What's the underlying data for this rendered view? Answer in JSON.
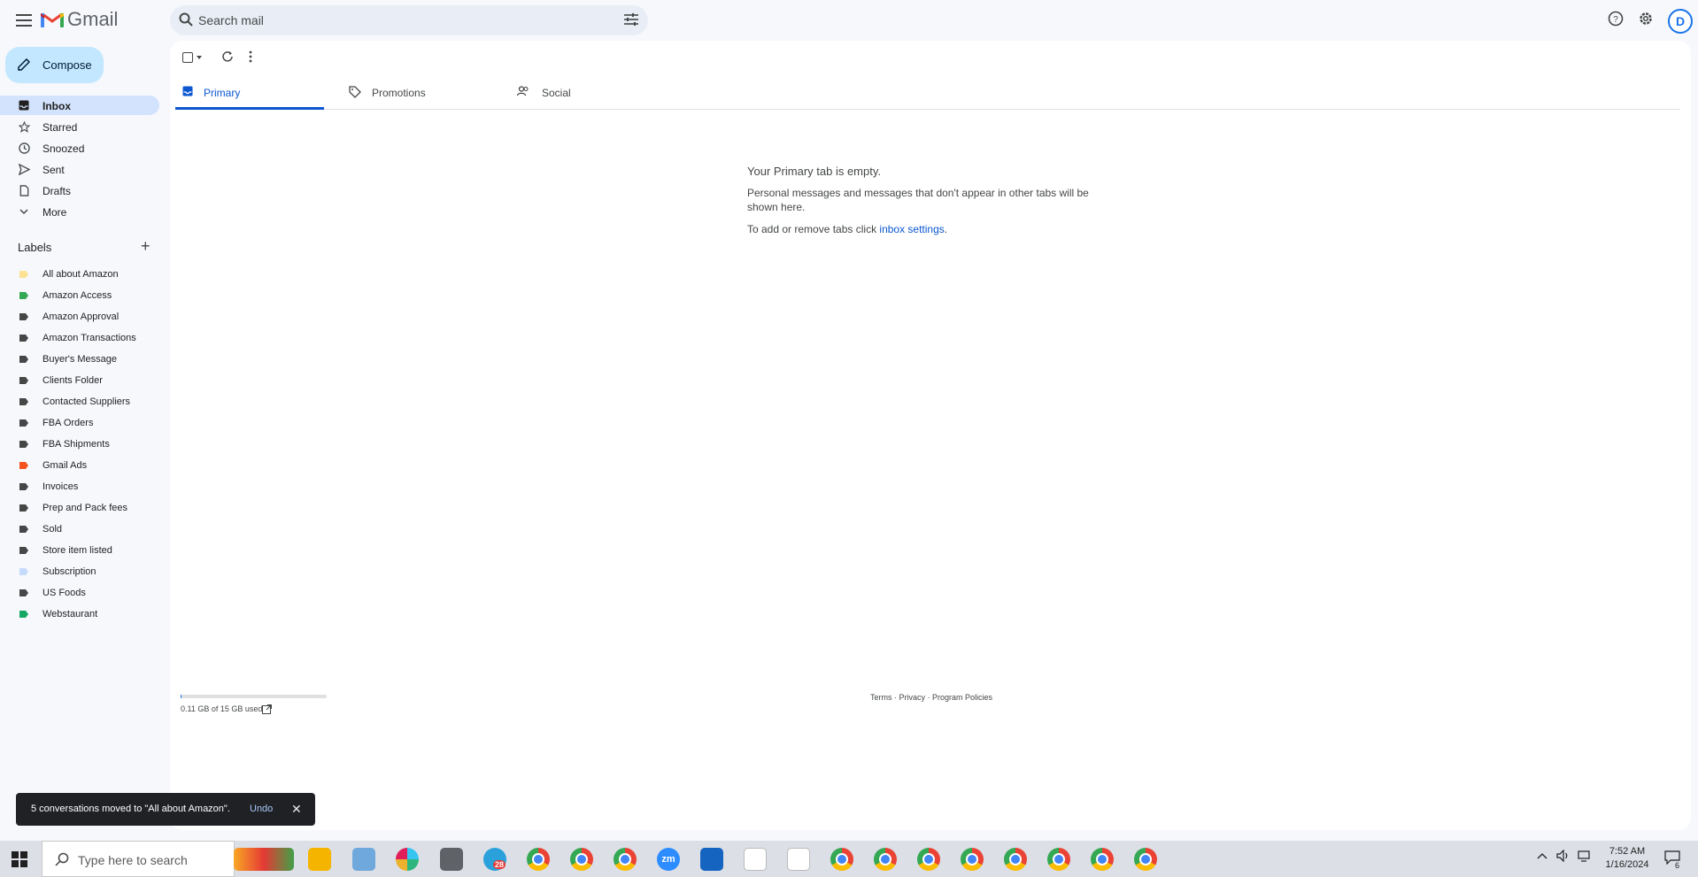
{
  "app": {
    "title": "Gmail"
  },
  "search": {
    "placeholder": "Search mail"
  },
  "sidebar": {
    "compose_label": "Compose",
    "items": [
      {
        "label": "Inbox",
        "icon": "inbox-icon",
        "active": true
      },
      {
        "label": "Starred",
        "icon": "star-icon"
      },
      {
        "label": "Snoozed",
        "icon": "clock-icon"
      },
      {
        "label": "Sent",
        "icon": "send-icon"
      },
      {
        "label": "Drafts",
        "icon": "draft-icon"
      },
      {
        "label": "More",
        "icon": "chevron-down-icon"
      }
    ],
    "labels_heading": "Labels",
    "labels": [
      {
        "label": "All about Amazon",
        "color": "#fde293"
      },
      {
        "label": "Amazon Access",
        "color": "#34a853"
      },
      {
        "label": "Amazon Approval",
        "color": "#444746"
      },
      {
        "label": "Amazon Transactions",
        "color": "#444746"
      },
      {
        "label": "Buyer's Message",
        "color": "#444746"
      },
      {
        "label": "Clients Folder",
        "color": "#444746"
      },
      {
        "label": "Contacted Suppliers",
        "color": "#444746"
      },
      {
        "label": "FBA Orders",
        "color": "#444746"
      },
      {
        "label": "FBA Shipments",
        "color": "#444746"
      },
      {
        "label": "Gmail Ads",
        "color": "#f4511e"
      },
      {
        "label": "Invoices",
        "color": "#444746"
      },
      {
        "label": "Prep and Pack fees",
        "color": "#444746"
      },
      {
        "label": "Sold",
        "color": "#444746"
      },
      {
        "label": "Store item listed",
        "color": "#444746"
      },
      {
        "label": "Subscription",
        "color": "#c6dafc"
      },
      {
        "label": "US Foods",
        "color": "#444746"
      },
      {
        "label": "Webstaurant",
        "color": "#16a765"
      }
    ]
  },
  "tabs": [
    {
      "label": "Primary",
      "icon": "inbox-icon",
      "active": true
    },
    {
      "label": "Promotions",
      "icon": "tag-icon"
    },
    {
      "label": "Social",
      "icon": "people-icon"
    }
  ],
  "empty_state": {
    "title": "Your Primary tab is empty.",
    "body": "Personal messages and messages that don't appear in other tabs will be shown here.",
    "settings_prefix": "To add or remove tabs click ",
    "settings_link": "inbox settings",
    "settings_suffix": "."
  },
  "storage": {
    "text": "0.11 GB of 15 GB used",
    "fraction": 0.007
  },
  "footer": {
    "links": "Terms · Privacy · Program Policies"
  },
  "snackbar": {
    "message": "5 conversations moved to \"All about Amazon\".",
    "undo": "Undo",
    "close": "✕"
  },
  "avatar": {
    "letter": "D"
  },
  "taskbar": {
    "search_placeholder": "Type here to search",
    "telegram_badge": "28",
    "zoom_label": "zm",
    "clock_time": "7:52 AM",
    "clock_date": "1/16/2024",
    "notification_count": "6"
  },
  "colors": {
    "accent": "#0b57d0",
    "compose_bg": "#c2e7ff",
    "active_nav": "#d3e3fd"
  }
}
